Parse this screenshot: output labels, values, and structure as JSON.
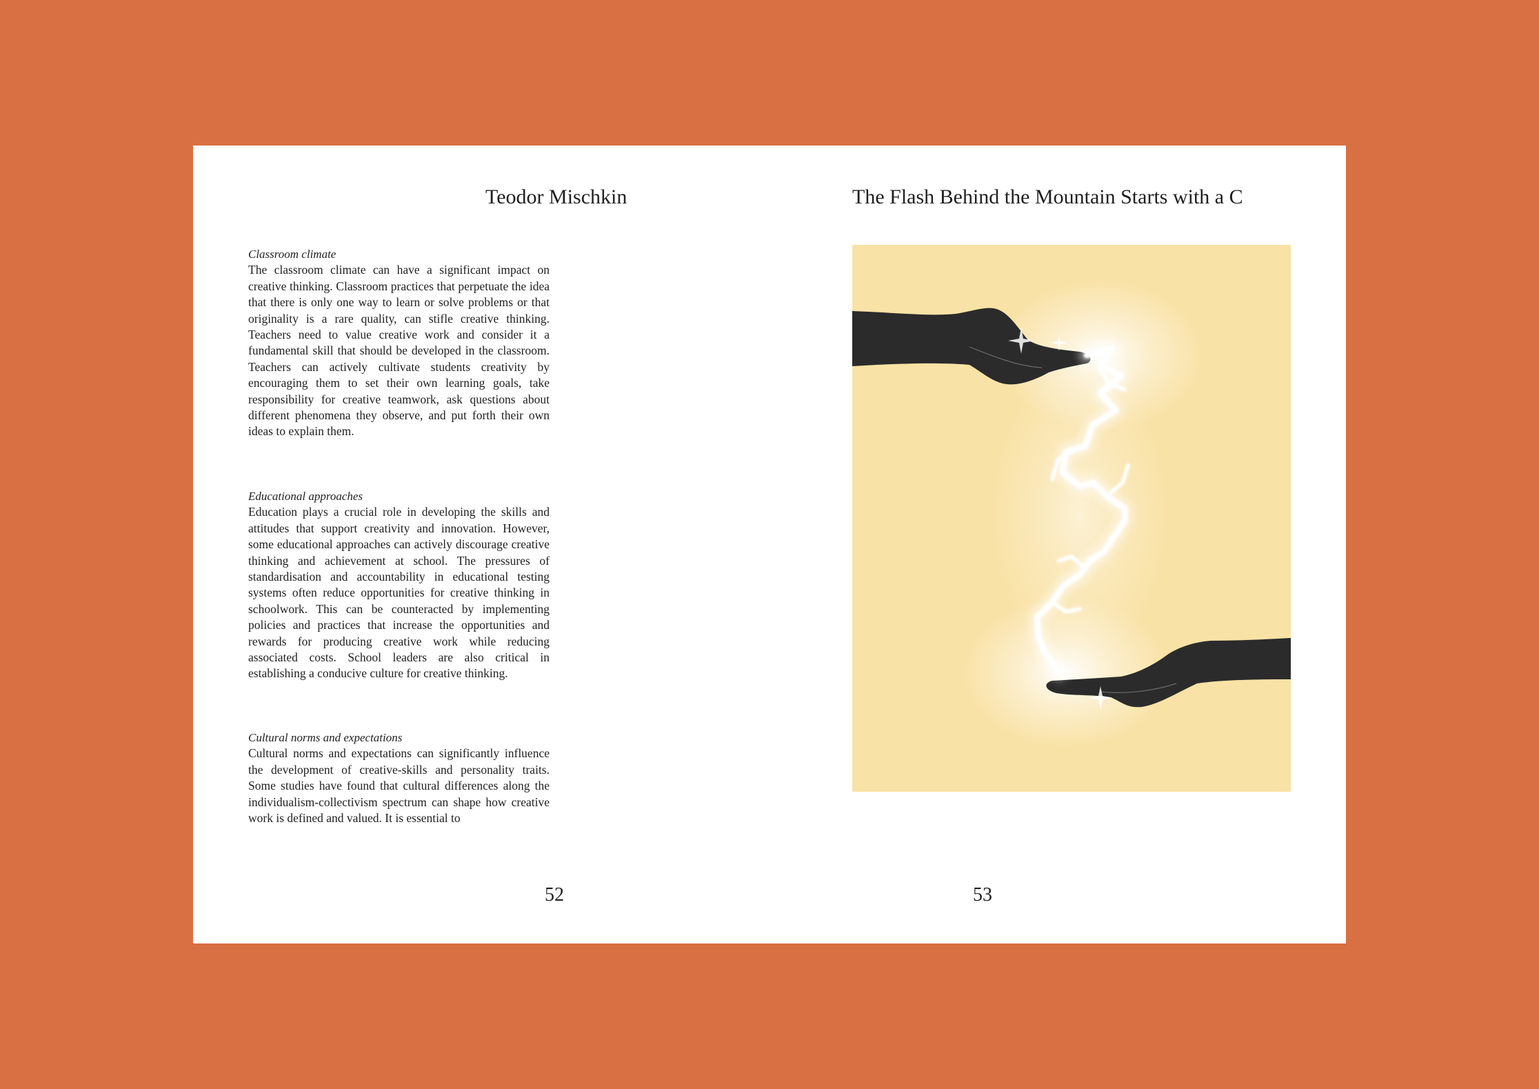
{
  "left_page": {
    "header": "Teodor Mischkin",
    "page_number": "52",
    "sections": [
      {
        "title": "Classroom climate",
        "body": "The classroom climate can have a significant impact on creative thinking. Classroom practices that perpetuate the idea that there is only one way to learn or solve problems or that originality is a rare quality, can stifle creative thinking. Teachers need to value creative work and consider it a fundamental skill that should be developed in the classroom. Teachers can actively cultivate students creativity by encouraging them to set their own learning goals, take responsibility for creative teamwork, ask questions about different phenomena they observe, and put forth their own ideas to explain them."
      },
      {
        "title": "Educational approaches",
        "body": "Education plays a crucial role in developing the skills and attitudes that support creativity and innovation. However, some educational approaches can actively discourage creative thinking and achievement at school. The pressures of standardisation and accountability in educational testing systems often reduce opportunities for creative thinking in schoolwork. This can be counteracted by implementing policies and practices that increase the opportunities and rewards for producing creative work while reducing associated costs. School leaders are also critical in establishing a conducive culture for creative thinking."
      },
      {
        "title": "Cultural norms and expectations",
        "body": "Cultural norms and expectations can significantly influence the development of creative-skills and personality traits. Some studies have found that cultural differences along the individualism-collectivism spectrum can shape how creative work is defined and valued. It is essential to"
      }
    ]
  },
  "right_page": {
    "header": "The Flash Behind the Mountain Starts with a C",
    "page_number": "53",
    "illustration": {
      "background_color": "#f9e2a6",
      "hand_color": "#2b2b2b",
      "glow_color": "#ffffff"
    }
  },
  "colors": {
    "background": "#d87043",
    "page": "#ffffff",
    "text": "#1f1f1f"
  }
}
